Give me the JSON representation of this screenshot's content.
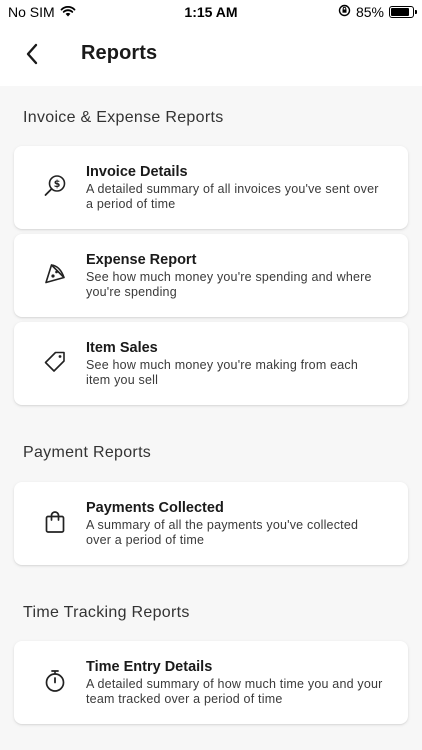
{
  "status_bar": {
    "carrier": "No SIM",
    "time": "1:15 AM",
    "battery": "85%",
    "battery_level": 0.85
  },
  "header": {
    "title": "Reports",
    "back_icon": "chevron-left-icon"
  },
  "sections": [
    {
      "title": "Invoice & Expense Reports",
      "items": [
        {
          "title": "Invoice Details",
          "description": "A detailed summary of all invoices you've sent over a period of time",
          "icon": "invoice-search-icon"
        },
        {
          "title": "Expense Report",
          "description": "See how much money you're spending and where you're spending",
          "icon": "pizza-slice-icon"
        },
        {
          "title": "Item Sales",
          "description": "See how much money you're making from each item you sell",
          "icon": "tag-icon"
        }
      ]
    },
    {
      "title": "Payment Reports",
      "items": [
        {
          "title": "Payments Collected",
          "description": "A summary of all the payments you've collected over a period of time",
          "icon": "shopping-bag-icon"
        }
      ]
    },
    {
      "title": "Time Tracking Reports",
      "items": [
        {
          "title": "Time Entry Details",
          "description": "A detailed summary of how much time you and your team tracked over a period of time",
          "icon": "stopwatch-icon"
        }
      ]
    }
  ]
}
